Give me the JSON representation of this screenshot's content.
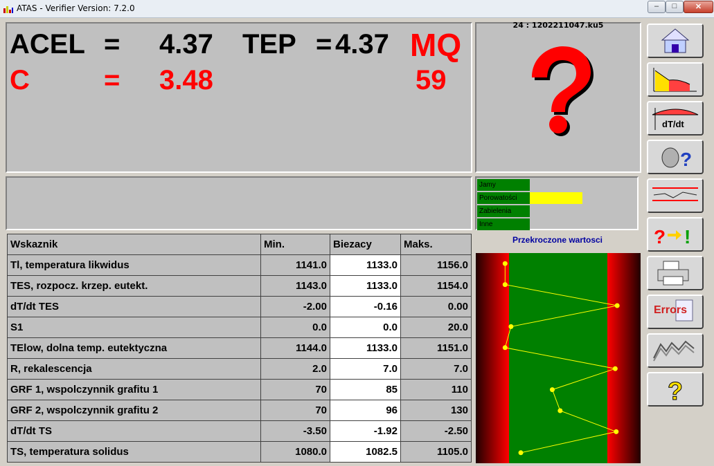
{
  "window": {
    "title": "ATAS - Verifier Version: 7.2.0",
    "min_label": "–",
    "max_label": "□",
    "close_label": "✕"
  },
  "summary": {
    "acel_label": "ACEL",
    "acel_eq": "=",
    "acel_value": "4.37",
    "tep_label": "TEP",
    "tep_eq": "=",
    "tep_value": "4.37",
    "mq_label": "MQ",
    "mq_value": "59",
    "c_label": "C",
    "c_eq": "=",
    "c_value": "3.48"
  },
  "file": {
    "label": "24 : 1202211047.ku5"
  },
  "defects": {
    "items": [
      {
        "label": "Jamy",
        "highlight": false
      },
      {
        "label": "Porowatości",
        "highlight": true
      },
      {
        "label": "Zabielenia",
        "highlight": false
      },
      {
        "label": "Inne",
        "highlight": false
      }
    ]
  },
  "table": {
    "headers": {
      "name": "Wskaznik",
      "min": "Min.",
      "cur": "Biezacy",
      "max": "Maks."
    },
    "rows": [
      {
        "name": "Tl, temperatura likwidus",
        "min": "1141.0",
        "cur": "1133.0",
        "max": "1156.0"
      },
      {
        "name": "TES, rozpocz. krzep. eutekt.",
        "min": "1143.0",
        "cur": "1133.0",
        "max": "1154.0"
      },
      {
        "name": "dT/dt TES",
        "min": "-2.00",
        "cur": "-0.16",
        "max": "0.00"
      },
      {
        "name": "S1",
        "min": "0.0",
        "cur": "0.0",
        "max": "20.0"
      },
      {
        "name": "TElow, dolna temp. eutektyczna",
        "min": "1144.0",
        "cur": "1133.0",
        "max": "1151.0"
      },
      {
        "name": "R, rekalescencja",
        "min": "2.0",
        "cur": "7.0",
        "max": "7.0"
      },
      {
        "name": "GRF 1, wspolczynnik grafitu 1",
        "min": "70",
        "cur": "85",
        "max": "110"
      },
      {
        "name": "GRF 2, wspolczynnik grafitu 2",
        "min": "70",
        "cur": "96",
        "max": "130"
      },
      {
        "name": "dT/dt TS",
        "min": "-3.50",
        "cur": "-1.92",
        "max": "-2.50"
      },
      {
        "name": "TS, temperatura solidus",
        "min": "1080.0",
        "cur": "1082.5",
        "max": "1105.0"
      }
    ]
  },
  "chart_data": {
    "type": "line",
    "title": "Przekroczone wartosci",
    "normalized_position": [
      -0.04,
      -0.04,
      1.1,
      0.02,
      -0.04,
      1.08,
      0.44,
      0.52,
      1.09,
      0.12
    ]
  },
  "sidebar": {
    "buttons": [
      {
        "name": "home-button",
        "icon": "home-icon"
      },
      {
        "name": "curve-chart-button",
        "icon": "curve-chart-icon"
      },
      {
        "name": "derivative-button",
        "icon": "derivative-icon",
        "label": "dT/dt"
      },
      {
        "name": "help-head-button",
        "icon": "head-question-icon"
      },
      {
        "name": "limits-button",
        "icon": "limits-icon"
      },
      {
        "name": "check-button",
        "icon": "question-arrow-icon"
      },
      {
        "name": "print-button",
        "icon": "printer-icon"
      },
      {
        "name": "errors-button",
        "icon": "errors-icon",
        "label": "Errors"
      },
      {
        "name": "history-button",
        "icon": "history-icon"
      },
      {
        "name": "help-button",
        "icon": "question-icon"
      }
    ]
  },
  "colors": {
    "accent_red": "#ff0000",
    "ok_green": "#008000",
    "highlight_yellow": "#ffff00",
    "point_yellow": "#ffff00"
  }
}
